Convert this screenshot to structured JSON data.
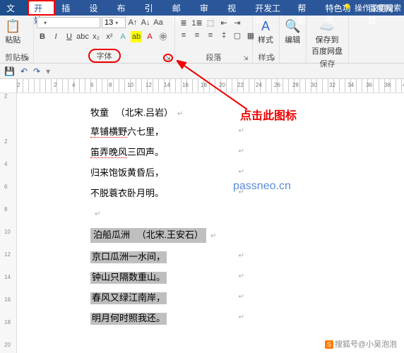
{
  "menu": {
    "file": "文件",
    "home": "开始",
    "insert": "插入",
    "design": "设计",
    "layout": "布局",
    "references": "引用",
    "mailings": "邮件",
    "review": "审阅",
    "view": "视图",
    "devtools": "开发工具",
    "help": "帮助",
    "special": "特色功能",
    "baidu": "百度网盘",
    "tell_me": "操作说明搜索"
  },
  "ribbon": {
    "clipboard": {
      "paste": "粘贴",
      "label": "剪贴板"
    },
    "font": {
      "size": "13",
      "bold": "B",
      "italic": "I",
      "underline": "U",
      "label": "字体"
    },
    "paragraph": {
      "label": "段落"
    },
    "styles": {
      "label": "样式"
    },
    "editing": {
      "label": "编辑"
    },
    "save": {
      "save_to": "保存到",
      "baidu": "百度网盘",
      "label": "保存"
    }
  },
  "doc": {
    "title_main": "牧童",
    "title_sub": "（北宋.吕岩）",
    "poem1_l1_a": "草铺横野",
    "poem1_l1_b": "六七里，",
    "poem1_l2_a": "笛弄晚风",
    "poem1_l2_b": "三四声。",
    "poem1_l3": "归来饱饭黄昏后，",
    "poem1_l4": "不脱蓑衣卧月明。",
    "title2_main": "泊船瓜洲",
    "title2_sub": "（北宋.王安石）",
    "poem2_l1": "京口瓜洲一水间，",
    "poem2_l2": "钟山只隔数重山。",
    "poem2_l3": "春风又绿江南岸，",
    "poem2_l4": "明月何时照我还。"
  },
  "annotation": {
    "text": "点击此图标"
  },
  "watermark": "passneo.cn",
  "credit": "搜狐号@小吴泡泡",
  "ruler_h": [
    "2",
    "",
    "2",
    "4",
    "6",
    "8",
    "10",
    "12",
    "14",
    "16",
    "18",
    "20",
    "22",
    "24",
    "26",
    "28",
    "30",
    "32",
    "34",
    "36",
    "38",
    "40"
  ],
  "ruler_v": [
    "2",
    "",
    "2",
    "4",
    "6",
    "8",
    "10",
    "12",
    "14",
    "16",
    "18",
    "20"
  ]
}
